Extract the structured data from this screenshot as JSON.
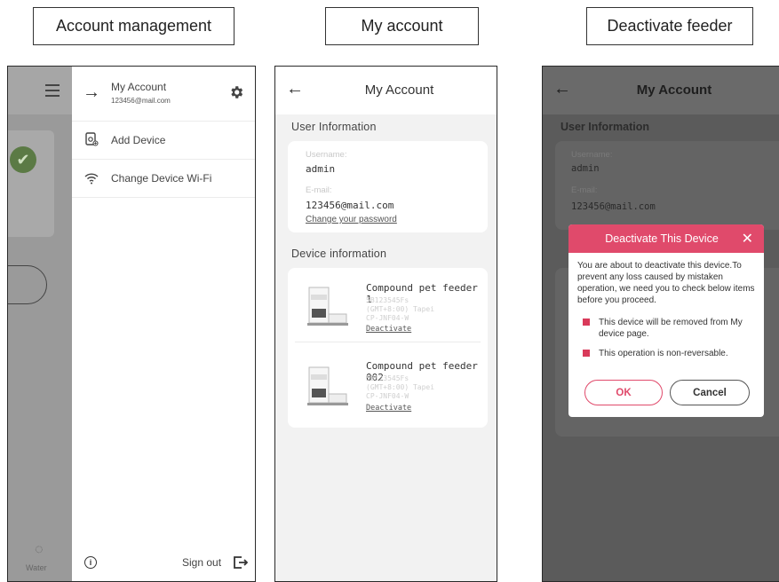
{
  "captions": {
    "account_management": "Account management",
    "my_account": "My account",
    "deactivate_feeder": "Deactivate feeder"
  },
  "screen1": {
    "background": {
      "water_label": "Water"
    },
    "drawer": {
      "account_title": "My Account",
      "account_email": "123456@mail.com",
      "menu": [
        {
          "label": "Add Device",
          "icon": "add-device-icon"
        },
        {
          "label": "Change Device Wi-Fi",
          "icon": "wifi-icon"
        }
      ],
      "sign_out": "Sign out"
    }
  },
  "screen2": {
    "title": "My Account",
    "user_section": "User Information",
    "username_label": "Username:",
    "username": "admin",
    "email_label": "E-mail:",
    "email": "123456@mail.com",
    "change_password": "Change your password",
    "device_section": "Device information",
    "devices": [
      {
        "name": "Compound pet feeder 1",
        "serial": "5B123545Fs",
        "timezone": "(GMT+8:00) Tapei",
        "model": "CP-JNF04-W",
        "action": "Deactivate"
      },
      {
        "name": "Compound pet feeder 002",
        "serial": "5B123545Fs",
        "timezone": "(GMT+8:00) Tapei",
        "model": "CP-JNF04-W",
        "action": "Deactivate"
      }
    ]
  },
  "screen3": {
    "title": "My Account",
    "user_section": "User Information",
    "username_label": "Username:",
    "username": "admin",
    "email_label": "E-mail:",
    "email": "123456@mail.com",
    "modal": {
      "title": "Deactivate This Device",
      "message": "You are about to deactivate this device.To prevent any loss caused by mistaken operation, we need you to check below items before you proceed.",
      "items": [
        "This device will be removed from My device page.",
        "This operation is non-reversable."
      ],
      "ok": "OK",
      "cancel": "Cancel"
    }
  },
  "colors": {
    "accent": "#e04a6b",
    "checkbox": "#d93a5a"
  }
}
